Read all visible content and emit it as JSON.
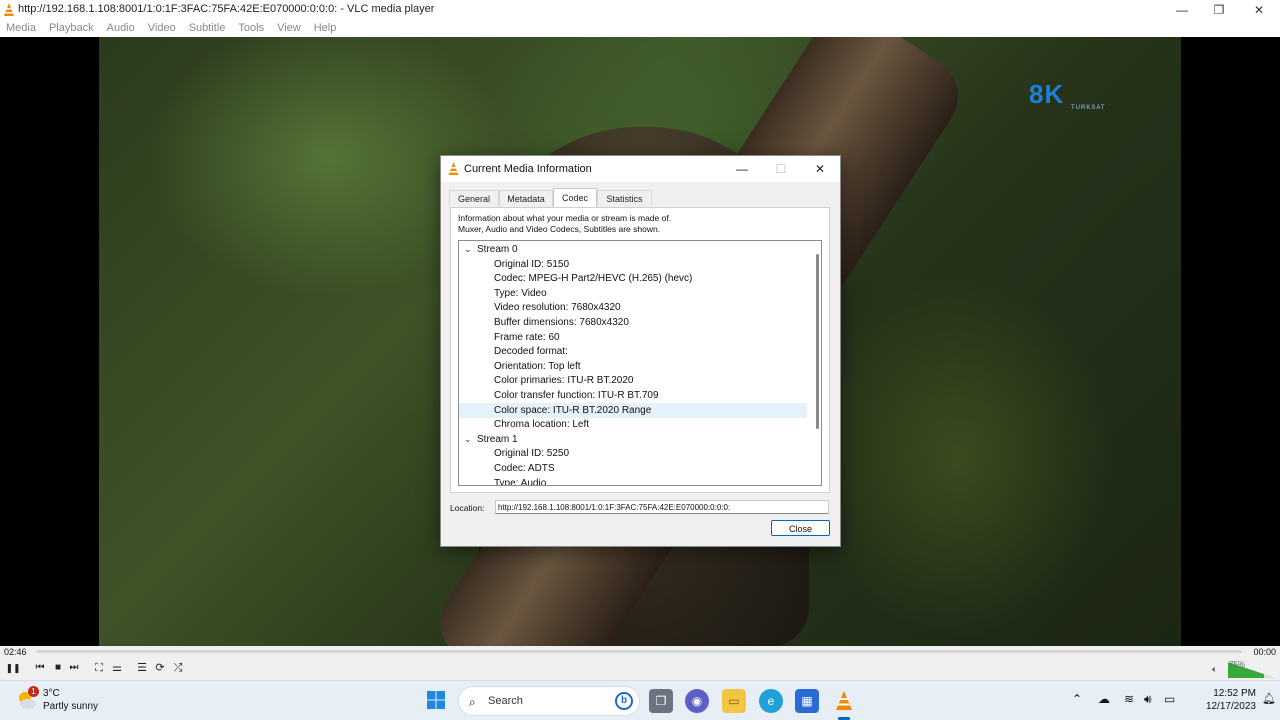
{
  "window": {
    "title": "http://192.168.1.108:8001/1:0:1F:3FAC:75FA:42E:E070000:0:0:0: - VLC media player",
    "minimize": "—",
    "maximize": "❐",
    "close": "✕"
  },
  "menu": [
    "Media",
    "Playback",
    "Audio",
    "Video",
    "Subtitle",
    "Tools",
    "View",
    "Help"
  ],
  "video": {
    "logo_text": "8K",
    "logo_sub": "TURKSAT"
  },
  "dialog": {
    "title": "Current Media Information",
    "minimize": "—",
    "maximize": "☐",
    "close": "✕",
    "tabs": [
      "General",
      "Metadata",
      "Codec",
      "Statistics"
    ],
    "active_tab": "Codec",
    "info_line1": "Information about what your media or stream is made of.",
    "info_line2": "Muxer, Audio and Video Codecs, Subtitles are shown.",
    "tree": [
      {
        "label": "Stream 0",
        "level": 0
      },
      {
        "label": "Original ID: 5150",
        "level": 1
      },
      {
        "label": "Codec: MPEG-H Part2/HEVC (H.265) (hevc)",
        "level": 1
      },
      {
        "label": "Type: Video",
        "level": 1
      },
      {
        "label": "Video resolution: 7680x4320",
        "level": 1
      },
      {
        "label": "Buffer dimensions: 7680x4320",
        "level": 1
      },
      {
        "label": "Frame rate: 60",
        "level": 1
      },
      {
        "label": "Decoded format:",
        "level": 1
      },
      {
        "label": "Orientation: Top left",
        "level": 1
      },
      {
        "label": "Color primaries: ITU-R BT.2020",
        "level": 1
      },
      {
        "label": "Color transfer function: ITU-R BT.709",
        "level": 1
      },
      {
        "label": "Color space: ITU-R BT.2020 Range",
        "level": 1,
        "selected": true
      },
      {
        "label": "Chroma location: Left",
        "level": 1
      },
      {
        "label": "Stream 1",
        "level": 0
      },
      {
        "label": "Original ID: 5250",
        "level": 1
      },
      {
        "label": "Codec: ADTS",
        "level": 1
      },
      {
        "label": "Type: Audio",
        "level": 1
      }
    ],
    "location_label": "Location:",
    "location_value": "http://192.168.1.108:8001/1:0:1F:3FAC:75FA:42E:E070000:0:0:0:",
    "close_button": "Close"
  },
  "player": {
    "elapsed": "02:46",
    "remaining": "00:00",
    "volume_label": "75%",
    "volume": 0.75,
    "buttons": {
      "pause": "❚❚",
      "prev": "⏮",
      "stop": "■",
      "next": "⏭",
      "fullscreen": "⛶",
      "ext": "⚌",
      "playlist": "☰",
      "loop": "⟳",
      "shuffle": "⤮"
    }
  },
  "taskbar": {
    "weather_badge": "1",
    "temperature": "3°C",
    "condition": "Partly sunny",
    "search_placeholder": "Search",
    "bing_letter": "b",
    "time": "12:52 PM",
    "date": "12/17/2023",
    "tray_icons": [
      "chevron-up-icon",
      "cloud-icon",
      "wifi-icon",
      "speaker-icon",
      "battery-icon"
    ]
  },
  "colors": {
    "accent": "#0067c0",
    "vlc_orange": "#f08a00",
    "logo_blue": "#1e7fd6"
  }
}
